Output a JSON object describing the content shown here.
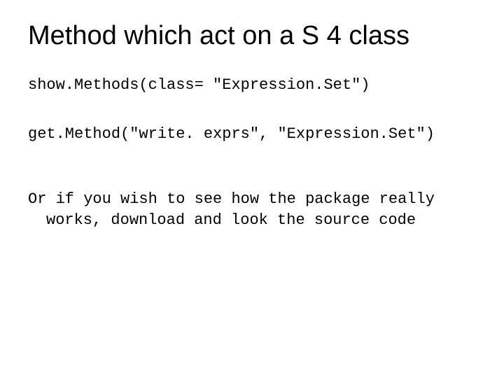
{
  "slide": {
    "title": "Method which act on a S 4 class",
    "code1": "show.Methods(class= \"Expression.Set\")",
    "code2": "get.Method(\"write. exprs\", \"Expression.Set\")",
    "note_line1": "Or if you wish to see how the package really",
    "note_line2": "works, download and look the source code"
  }
}
